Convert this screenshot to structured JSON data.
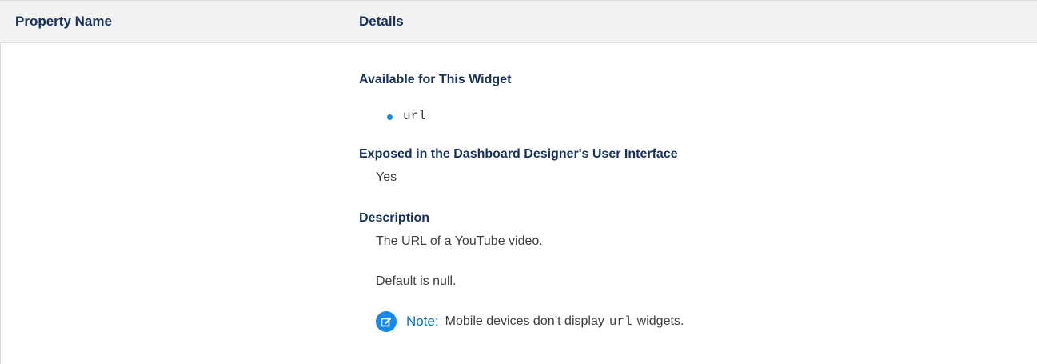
{
  "table": {
    "header": {
      "property_name": "Property Name",
      "details": "Details"
    },
    "row": {
      "property_name": "",
      "available_heading": "Available for This Widget",
      "available_items": [
        "url"
      ],
      "exposed_heading": "Exposed in the Dashboard Designer's User Interface",
      "exposed_value": "Yes",
      "description_heading": "Description",
      "description_text": "The URL of a YouTube video.",
      "default_text": "Default is null.",
      "note": {
        "icon": "edit-note-icon",
        "label": "Note:",
        "text_before": "Mobile devices don’t display",
        "code": "url",
        "text_after": "widgets."
      }
    }
  },
  "colors": {
    "header_bg": "#f3f2f2",
    "heading_text": "#16325c",
    "accent_blue": "#1589ee",
    "note_label": "#0070d2",
    "body_text": "#3e3e3c"
  }
}
